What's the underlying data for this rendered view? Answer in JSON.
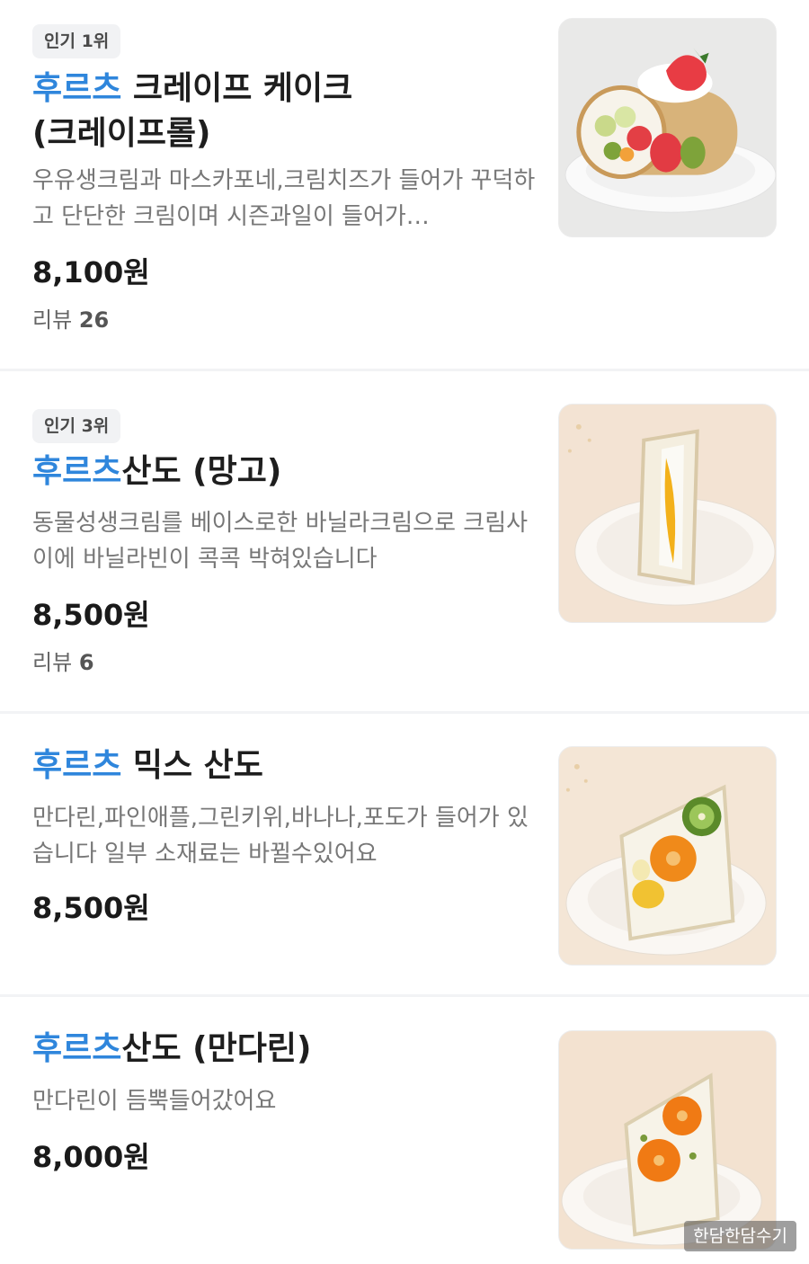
{
  "items": [
    {
      "badge": "인기 1위",
      "brand": "후르츠",
      "title_rest": " 크레이프 케이크",
      "title_line2": "(크레이프롤)",
      "description": "우유생크림과 마스카포네,크림치즈가 들어가 꾸덕하고 단단한 크림이며 시즌과일이 들어가…",
      "price": "8,100원",
      "review_label": "리뷰",
      "review_count": "26",
      "image_icon": "crepe-roll-cake-photo"
    },
    {
      "badge": "인기 3위",
      "brand": "후르츠",
      "title_rest": "산도 (망고)",
      "description": "동물성생크림를 베이스로한 바닐라크림으로 크림사이에 바닐라빈이 콕콕 박혀있습니다",
      "price": "8,500원",
      "review_label": "리뷰",
      "review_count": "6",
      "image_icon": "mango-sando-photo"
    },
    {
      "brand": "후르츠",
      "title_rest": " 믹스 산도",
      "description": "만다린,파인애플,그린키위,바나나,포도가 들어가 있습니다 일부 소재료는 바뀔수있어요",
      "price": "8,500원",
      "image_icon": "mix-sando-photo"
    },
    {
      "brand": "후르츠",
      "title_rest": "산도 (만다린)",
      "description": "만다린이 듬뿍들어갔어요",
      "price": "8,000원",
      "image_icon": "mandarin-sando-photo"
    }
  ],
  "watermark": "한담한담수기",
  "colors": {
    "brand": "#2f86dc",
    "badge_bg": "#f1f2f4",
    "divider": "#f2f3f5"
  }
}
